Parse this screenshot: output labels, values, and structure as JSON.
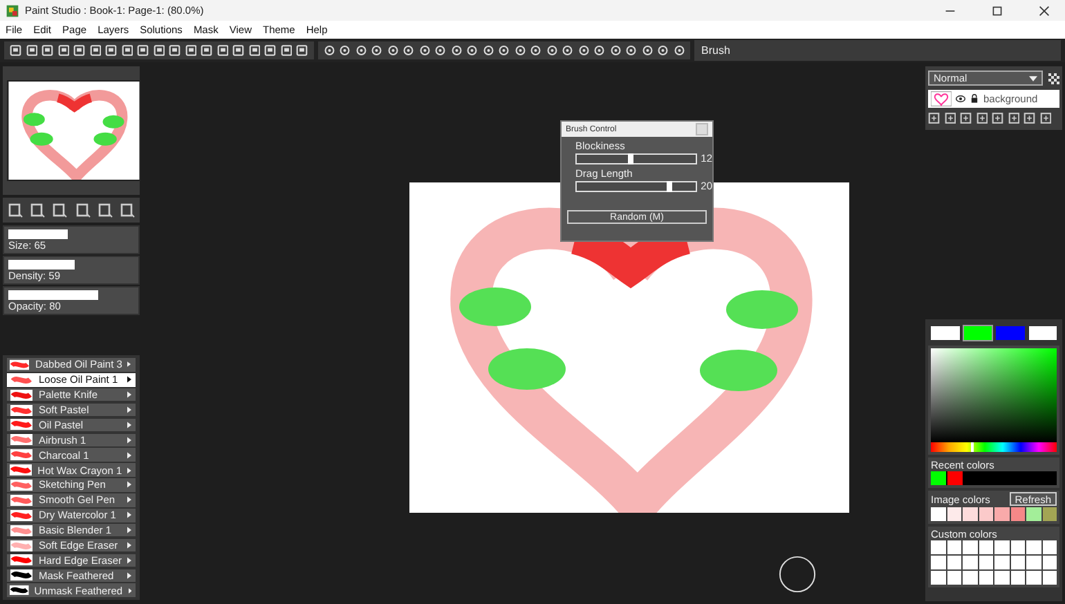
{
  "window": {
    "title": "Paint Studio : Book-1: Page-1:  (80.0%)"
  },
  "menu": [
    "File",
    "Edit",
    "Page",
    "Layers",
    "Solutions",
    "Mask",
    "View",
    "Theme",
    "Help"
  ],
  "toolbar": {
    "label": "Brush"
  },
  "brush_settings": [
    {
      "label": "Size: 65",
      "level": 0.5
    },
    {
      "label": "Density: 59",
      "level": 0.55
    },
    {
      "label": "Opacity: 80",
      "level": 0.75
    }
  ],
  "brushes": [
    {
      "name": "Dabbed Oil Paint 3",
      "color": "#ff2a2a",
      "selected": false
    },
    {
      "name": "Loose Oil Paint 1",
      "color": "#ff5050",
      "selected": true
    },
    {
      "name": "Palette Knife",
      "color": "#ee1111",
      "selected": false
    },
    {
      "name": "Soft Pastel",
      "color": "#ff3030",
      "selected": false
    },
    {
      "name": "Oil Pastel",
      "color": "#ff1a1a",
      "selected": false
    },
    {
      "name": "Airbrush 1",
      "color": "#ff7070",
      "selected": false
    },
    {
      "name": "Charcoal 1",
      "color": "#ff4040",
      "selected": false
    },
    {
      "name": "Hot Wax Crayon 1",
      "color": "#ff1010",
      "selected": false
    },
    {
      "name": "Sketching Pen",
      "color": "#ff6060",
      "selected": false
    },
    {
      "name": "Smooth Gel Pen",
      "color": "#ff5a5a",
      "selected": false
    },
    {
      "name": "Dry Watercolor 1",
      "color": "#ff2020",
      "selected": false
    },
    {
      "name": "Basic Blender 1",
      "color": "#ff9090",
      "selected": false
    },
    {
      "name": "Soft Edge Eraser",
      "color": "#ffb0b0",
      "selected": false
    },
    {
      "name": "Hard Edge Eraser",
      "color": "#ff0000",
      "selected": false
    },
    {
      "name": "Mask Feathered",
      "color": "#000000",
      "selected": false
    },
    {
      "name": "Unmask Feathered",
      "color": "#000000",
      "selected": false
    }
  ],
  "brush_control": {
    "title": "Brush Control",
    "sliders": [
      {
        "label": "Blockiness",
        "level": 0.45,
        "reading": "12"
      },
      {
        "label": "Drag Length",
        "level": 0.78,
        "reading": "20"
      }
    ],
    "button": "Random (M)"
  },
  "layers": {
    "blend_mode": "Normal",
    "items": [
      {
        "name": "background"
      }
    ]
  },
  "color_slots": [
    {
      "color": "#ffffff",
      "selected": false
    },
    {
      "color": "#00ff00",
      "selected": true
    },
    {
      "color": "#0000ff",
      "selected": false
    },
    {
      "color": "#ffffff",
      "selected": false
    }
  ],
  "hue": {
    "level": 0.33
  },
  "recent_colors": {
    "label": "Recent colors",
    "colors": [
      {
        "color": "#00ff00"
      },
      {
        "color": "#ff0000"
      }
    ]
  },
  "image_colors": {
    "label": "Image colors",
    "button": "Refresh",
    "colors": [
      {
        "color": "#ffffff"
      },
      {
        "color": "#fdeaea"
      },
      {
        "color": "#fcdcdc"
      },
      {
        "color": "#fbcaca"
      },
      {
        "color": "#f9aaaa"
      },
      {
        "color": "#f58888"
      },
      {
        "color": "#a3ee99"
      },
      {
        "color": "#a3a554"
      }
    ]
  },
  "custom_colors": {
    "label": "Custom colors"
  }
}
